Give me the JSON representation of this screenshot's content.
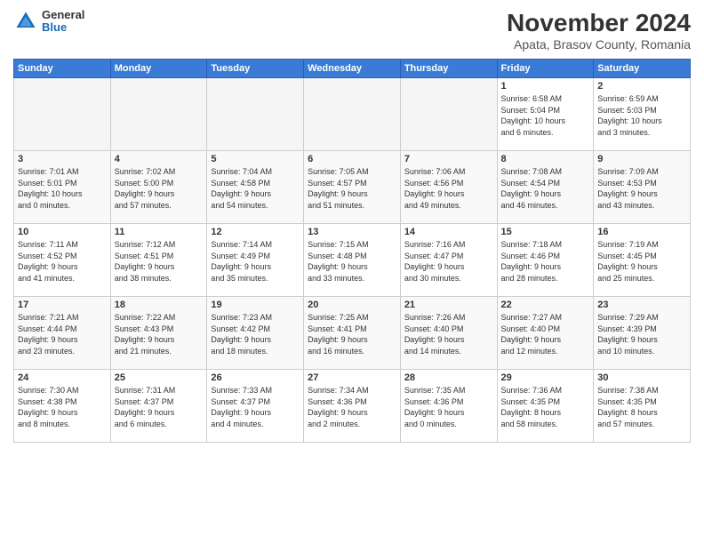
{
  "header": {
    "logo_general": "General",
    "logo_blue": "Blue",
    "month_title": "November 2024",
    "location": "Apata, Brasov County, Romania"
  },
  "weekdays": [
    "Sunday",
    "Monday",
    "Tuesday",
    "Wednesday",
    "Thursday",
    "Friday",
    "Saturday"
  ],
  "weeks": [
    [
      {
        "day": "",
        "info": ""
      },
      {
        "day": "",
        "info": ""
      },
      {
        "day": "",
        "info": ""
      },
      {
        "day": "",
        "info": ""
      },
      {
        "day": "",
        "info": ""
      },
      {
        "day": "1",
        "info": "Sunrise: 6:58 AM\nSunset: 5:04 PM\nDaylight: 10 hours\nand 6 minutes."
      },
      {
        "day": "2",
        "info": "Sunrise: 6:59 AM\nSunset: 5:03 PM\nDaylight: 10 hours\nand 3 minutes."
      }
    ],
    [
      {
        "day": "3",
        "info": "Sunrise: 7:01 AM\nSunset: 5:01 PM\nDaylight: 10 hours\nand 0 minutes."
      },
      {
        "day": "4",
        "info": "Sunrise: 7:02 AM\nSunset: 5:00 PM\nDaylight: 9 hours\nand 57 minutes."
      },
      {
        "day": "5",
        "info": "Sunrise: 7:04 AM\nSunset: 4:58 PM\nDaylight: 9 hours\nand 54 minutes."
      },
      {
        "day": "6",
        "info": "Sunrise: 7:05 AM\nSunset: 4:57 PM\nDaylight: 9 hours\nand 51 minutes."
      },
      {
        "day": "7",
        "info": "Sunrise: 7:06 AM\nSunset: 4:56 PM\nDaylight: 9 hours\nand 49 minutes."
      },
      {
        "day": "8",
        "info": "Sunrise: 7:08 AM\nSunset: 4:54 PM\nDaylight: 9 hours\nand 46 minutes."
      },
      {
        "day": "9",
        "info": "Sunrise: 7:09 AM\nSunset: 4:53 PM\nDaylight: 9 hours\nand 43 minutes."
      }
    ],
    [
      {
        "day": "10",
        "info": "Sunrise: 7:11 AM\nSunset: 4:52 PM\nDaylight: 9 hours\nand 41 minutes."
      },
      {
        "day": "11",
        "info": "Sunrise: 7:12 AM\nSunset: 4:51 PM\nDaylight: 9 hours\nand 38 minutes."
      },
      {
        "day": "12",
        "info": "Sunrise: 7:14 AM\nSunset: 4:49 PM\nDaylight: 9 hours\nand 35 minutes."
      },
      {
        "day": "13",
        "info": "Sunrise: 7:15 AM\nSunset: 4:48 PM\nDaylight: 9 hours\nand 33 minutes."
      },
      {
        "day": "14",
        "info": "Sunrise: 7:16 AM\nSunset: 4:47 PM\nDaylight: 9 hours\nand 30 minutes."
      },
      {
        "day": "15",
        "info": "Sunrise: 7:18 AM\nSunset: 4:46 PM\nDaylight: 9 hours\nand 28 minutes."
      },
      {
        "day": "16",
        "info": "Sunrise: 7:19 AM\nSunset: 4:45 PM\nDaylight: 9 hours\nand 25 minutes."
      }
    ],
    [
      {
        "day": "17",
        "info": "Sunrise: 7:21 AM\nSunset: 4:44 PM\nDaylight: 9 hours\nand 23 minutes."
      },
      {
        "day": "18",
        "info": "Sunrise: 7:22 AM\nSunset: 4:43 PM\nDaylight: 9 hours\nand 21 minutes."
      },
      {
        "day": "19",
        "info": "Sunrise: 7:23 AM\nSunset: 4:42 PM\nDaylight: 9 hours\nand 18 minutes."
      },
      {
        "day": "20",
        "info": "Sunrise: 7:25 AM\nSunset: 4:41 PM\nDaylight: 9 hours\nand 16 minutes."
      },
      {
        "day": "21",
        "info": "Sunrise: 7:26 AM\nSunset: 4:40 PM\nDaylight: 9 hours\nand 14 minutes."
      },
      {
        "day": "22",
        "info": "Sunrise: 7:27 AM\nSunset: 4:40 PM\nDaylight: 9 hours\nand 12 minutes."
      },
      {
        "day": "23",
        "info": "Sunrise: 7:29 AM\nSunset: 4:39 PM\nDaylight: 9 hours\nand 10 minutes."
      }
    ],
    [
      {
        "day": "24",
        "info": "Sunrise: 7:30 AM\nSunset: 4:38 PM\nDaylight: 9 hours\nand 8 minutes."
      },
      {
        "day": "25",
        "info": "Sunrise: 7:31 AM\nSunset: 4:37 PM\nDaylight: 9 hours\nand 6 minutes."
      },
      {
        "day": "26",
        "info": "Sunrise: 7:33 AM\nSunset: 4:37 PM\nDaylight: 9 hours\nand 4 minutes."
      },
      {
        "day": "27",
        "info": "Sunrise: 7:34 AM\nSunset: 4:36 PM\nDaylight: 9 hours\nand 2 minutes."
      },
      {
        "day": "28",
        "info": "Sunrise: 7:35 AM\nSunset: 4:36 PM\nDaylight: 9 hours\nand 0 minutes."
      },
      {
        "day": "29",
        "info": "Sunrise: 7:36 AM\nSunset: 4:35 PM\nDaylight: 8 hours\nand 58 minutes."
      },
      {
        "day": "30",
        "info": "Sunrise: 7:38 AM\nSunset: 4:35 PM\nDaylight: 8 hours\nand 57 minutes."
      }
    ]
  ]
}
